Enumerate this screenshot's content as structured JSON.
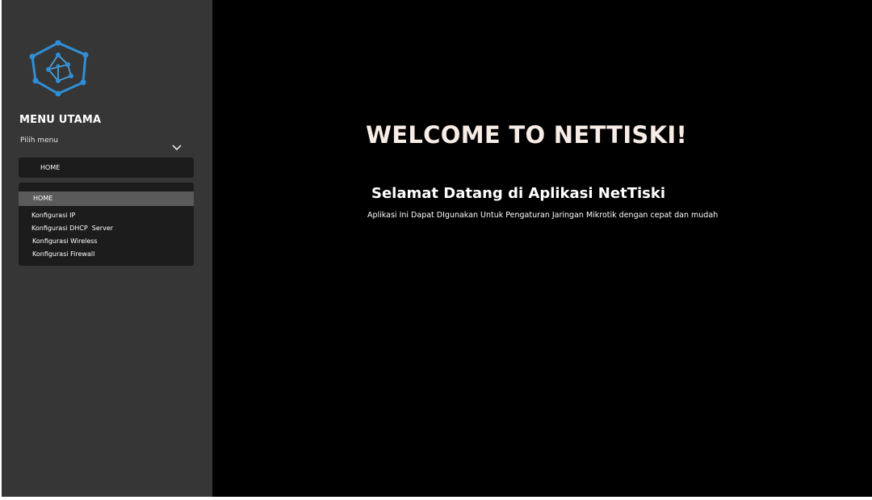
{
  "sidebar": {
    "logo_icon": "network-hexagon-icon",
    "menu_title": "MENU UTAMA",
    "menu_subtitle": "Pilih menu",
    "select": {
      "selected_value": "HOME",
      "icon": "chevron-down-icon"
    },
    "options": [
      {
        "label": "HOME",
        "selected": true
      },
      {
        "label": "Konfigurasi IP",
        "selected": false
      },
      {
        "label": "Konfigurasi DHCP  Server",
        "selected": false
      },
      {
        "label": "Konfigurasi Wireless",
        "selected": false
      },
      {
        "label": "Konfigurasi Firewall",
        "selected": false
      }
    ]
  },
  "main": {
    "title": "WELCOME TO NETTISKI!",
    "subtitle": "Selamat Datang di Aplikasi NetTiski",
    "description": "Aplikasi Ini Dapat DIgunakan Untuk Pengaturan Jaringan Mikrotik dengan cepat dan mudah"
  },
  "colors": {
    "sidebar_bg": "#363636",
    "main_bg": "#000000",
    "dropdown_bg": "#1c1c1c",
    "selected_option_bg": "#5a5a5a",
    "logo_blue": "#2f8fd6",
    "title_color": "#f7ece6"
  }
}
